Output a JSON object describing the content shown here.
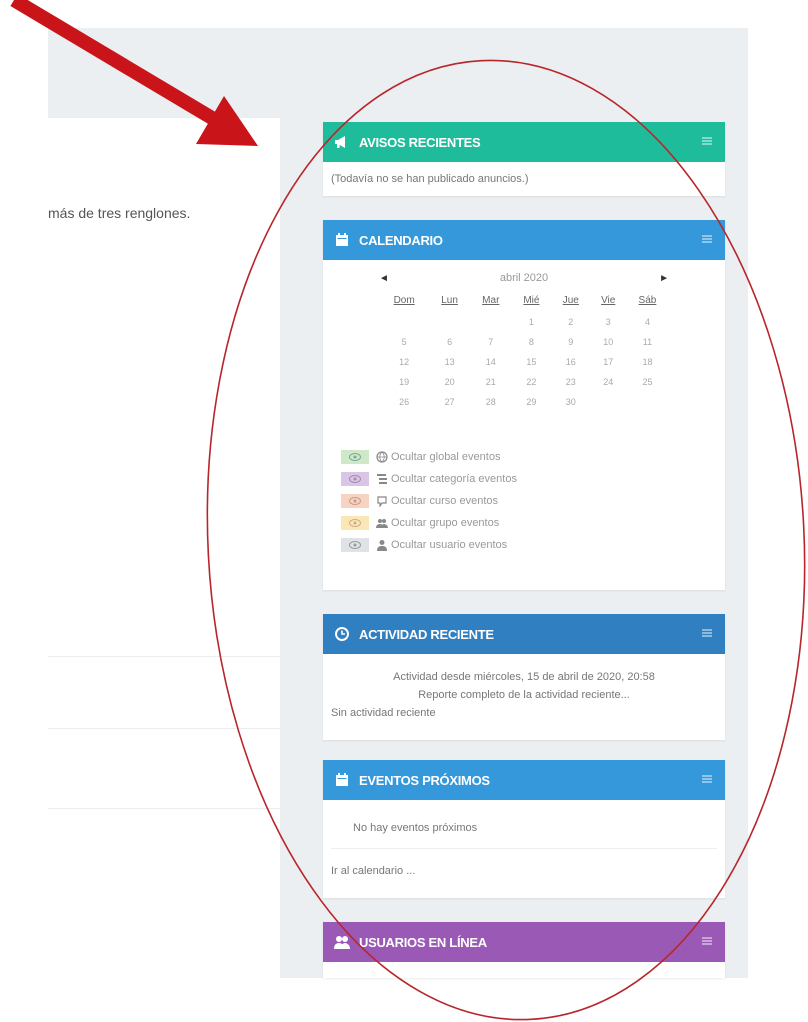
{
  "main": {
    "text_fragment": "más de tres renglones."
  },
  "colors": {
    "avisos": "#1fbc9c",
    "calendario": "#3498db",
    "actividad": "#2f7fc1",
    "eventos": "#3498db",
    "usuarios": "#9b59b6",
    "arrow": "#c9141a",
    "ellipse": "#b7262b"
  },
  "avisos": {
    "title": "AVISOS RECIENTES",
    "icon": "megaphone-icon",
    "empty_text": "(Todavía no se han publicado anuncios.)"
  },
  "calendario": {
    "title": "CALENDARIO",
    "icon": "calendar-icon",
    "month": "abril 2020",
    "prev": "◄",
    "next": "►",
    "weekdays": [
      "Dom",
      "Lun",
      "Mar",
      "Mié",
      "Jue",
      "Vie",
      "Sáb"
    ],
    "weeks": [
      [
        "",
        "",
        "",
        "1",
        "2",
        "3",
        "4"
      ],
      [
        "5",
        "6",
        "7",
        "8",
        "9",
        "10",
        "11"
      ],
      [
        "12",
        "13",
        "14",
        "15",
        "16",
        "17",
        "18"
      ],
      [
        "19",
        "20",
        "21",
        "22",
        "23",
        "24",
        "25"
      ],
      [
        "26",
        "27",
        "28",
        "29",
        "30",
        "",
        ""
      ]
    ],
    "legend": [
      {
        "label": "Ocultar global eventos",
        "icon": "globe-icon",
        "color": "#cfe9c8"
      },
      {
        "label": "Ocultar categoría eventos",
        "icon": "category-icon",
        "color": "#d9c6e6"
      },
      {
        "label": "Ocultar curso eventos",
        "icon": "course-icon",
        "color": "#f6d3c2"
      },
      {
        "label": "Ocultar grupo eventos",
        "icon": "group-icon",
        "color": "#fbe7b5"
      },
      {
        "label": "Ocultar usuario eventos",
        "icon": "user-icon",
        "color": "#dfe3e6"
      }
    ]
  },
  "actividad": {
    "title": "ACTIVIDAD RECIENTE",
    "icon": "clock-icon",
    "since": "Actividad desde miércoles, 15 de abril de 2020, 20:58",
    "report_link": "Reporte completo de la actividad reciente...",
    "none": "Sin actividad reciente"
  },
  "eventos": {
    "title": "EVENTOS PRÓXIMOS",
    "icon": "calendar-icon",
    "none": "No hay eventos próximos",
    "link": "Ir al calendario ..."
  },
  "usuarios": {
    "title": "USUARIOS EN LÍNEA",
    "icon": "users-icon"
  }
}
